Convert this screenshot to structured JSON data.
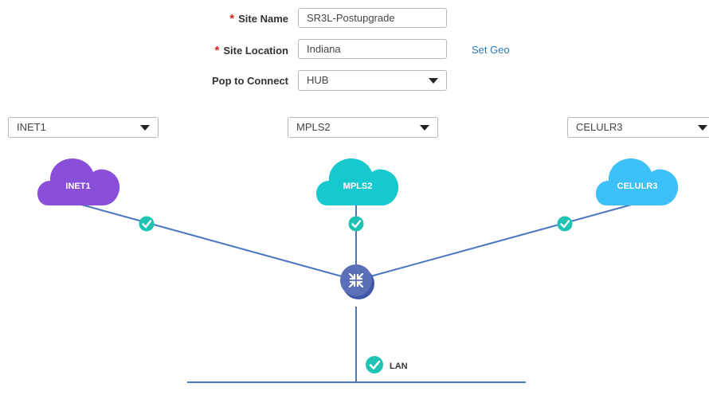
{
  "form": {
    "site_name": {
      "label": "Site Name",
      "required_mark": "*",
      "value": "SR3L-Postupgrade"
    },
    "site_location": {
      "label": "Site Location",
      "required_mark": "*",
      "value": "Indiana"
    },
    "set_geo": "Set Geo",
    "pop": {
      "label": "Pop to Connect",
      "selected": "HUB"
    }
  },
  "links": [
    {
      "selected": "INET1",
      "cloud_label": "INET1",
      "color": "#8a4fd8",
      "status": "connected"
    },
    {
      "selected": "MPLS2",
      "cloud_label": "MPLS2",
      "color": "#17c9cf",
      "status": "connected"
    },
    {
      "selected": "CELULR3",
      "cloud_label": "CELULR3",
      "color": "#3cc0f7",
      "status": "connected"
    }
  ],
  "lan": {
    "label": "LAN",
    "status": "connected"
  },
  "colors": {
    "line": "#4a78c0",
    "check": "#1fc3b4",
    "router": "#5a6fb8"
  },
  "icons": {
    "required": "asterisk",
    "dropdown": "caret-down-icon",
    "status": "check-circle-icon",
    "router": "router-icon"
  }
}
